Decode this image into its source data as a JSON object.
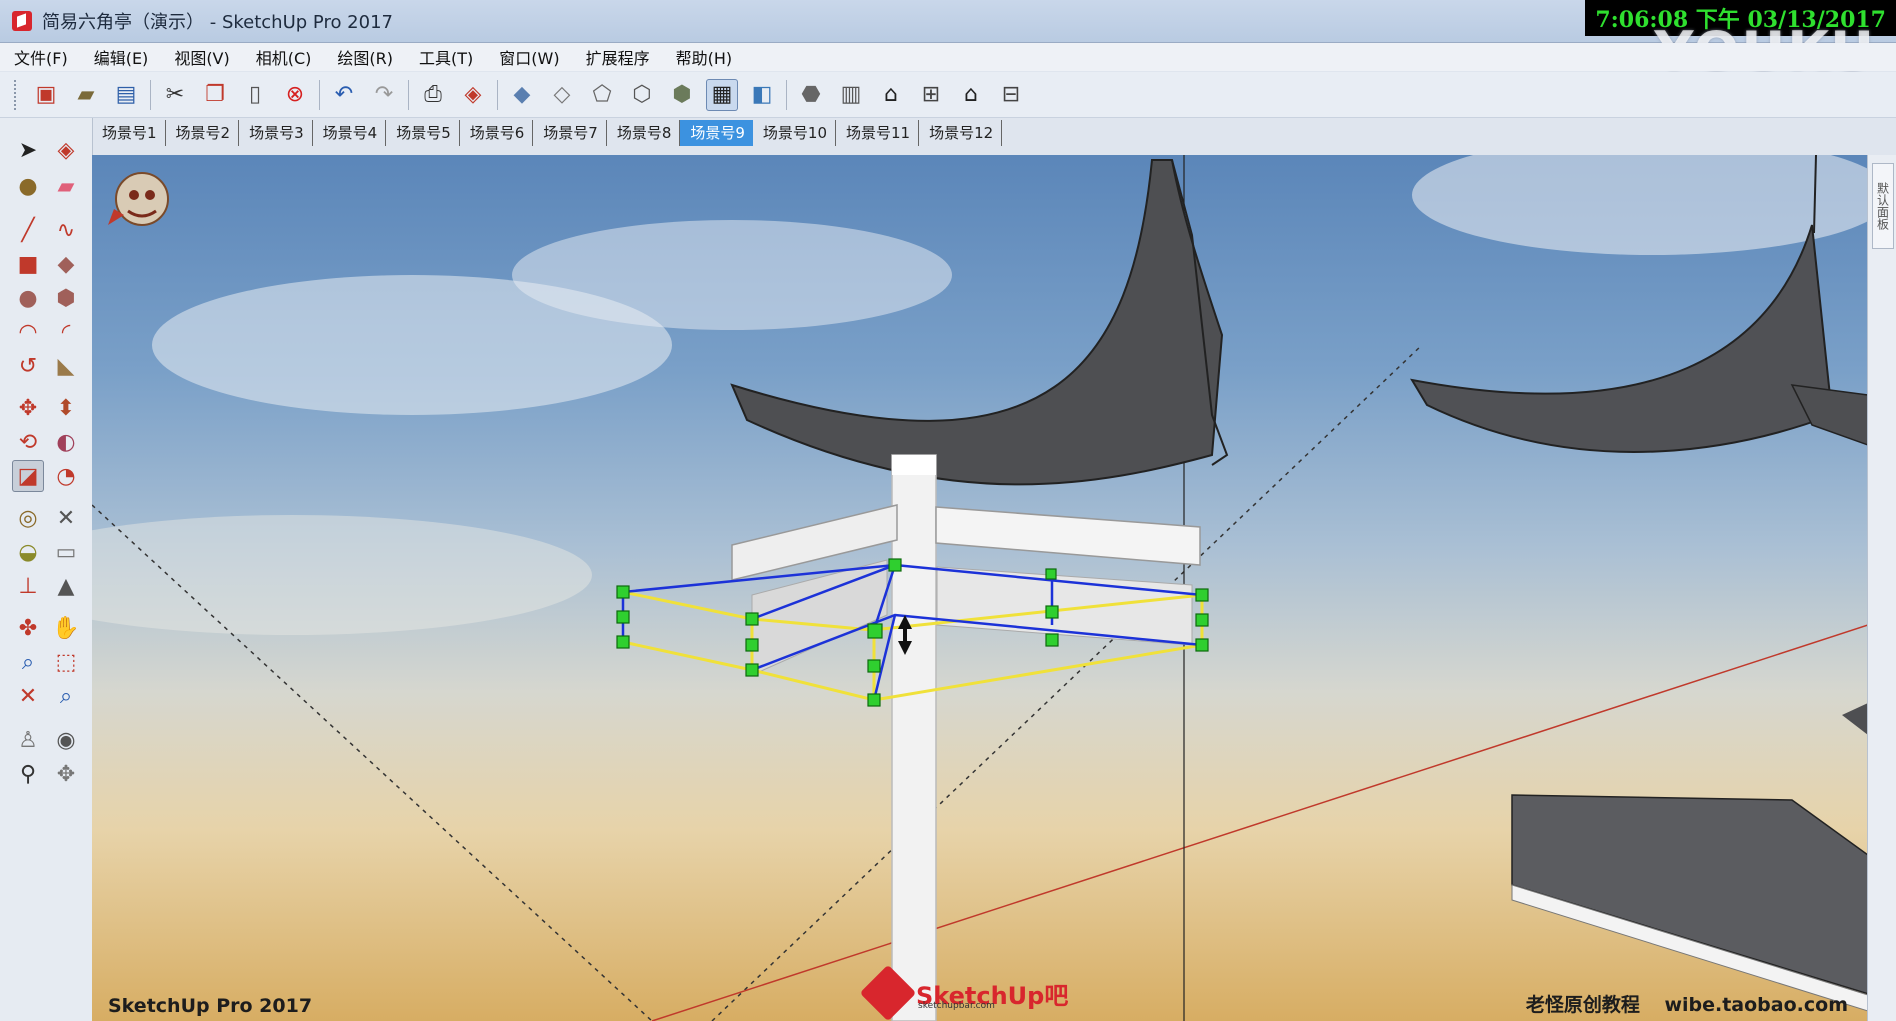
{
  "window": {
    "title": "简易六角亭（演示） - SketchUp Pro 2017",
    "clock": "7:06:08 下午 03/13/2017",
    "watermark": "YOUKU"
  },
  "menu": [
    {
      "label": "文件(F)"
    },
    {
      "label": "编辑(E)"
    },
    {
      "label": "视图(V)"
    },
    {
      "label": "相机(C)"
    },
    {
      "label": "绘图(R)"
    },
    {
      "label": "工具(T)"
    },
    {
      "label": "窗口(W)"
    },
    {
      "label": "扩展程序"
    },
    {
      "label": "帮助(H)"
    }
  ],
  "scene_tabs": [
    {
      "label": "场景号1"
    },
    {
      "label": "场景号2"
    },
    {
      "label": "场景号3"
    },
    {
      "label": "场景号4"
    },
    {
      "label": "场景号5"
    },
    {
      "label": "场景号6"
    },
    {
      "label": "场景号7"
    },
    {
      "label": "场景号8"
    },
    {
      "label": "场景号9",
      "active": true
    },
    {
      "label": "场景号10"
    },
    {
      "label": "场景号11"
    },
    {
      "label": "场景号12"
    }
  ],
  "viewport": {
    "bottom_left_label": "SketchUp Pro 2017",
    "bottom_right_author": "老怪原创教程",
    "bottom_right_site": "wibe.taobao.com",
    "logo_text": "SketchUp吧",
    "logo_sub": "sketchupbar.com"
  },
  "right_panel": {
    "label": "默认面板"
  },
  "colors": {
    "accent": "#3c92e0",
    "selection_yellow": "#f0e13a",
    "selection_blue": "#1c32d8",
    "grip_green": "#2fcf2f",
    "roof_gray": "#4e4f52",
    "axis_red": "#c0392b"
  }
}
